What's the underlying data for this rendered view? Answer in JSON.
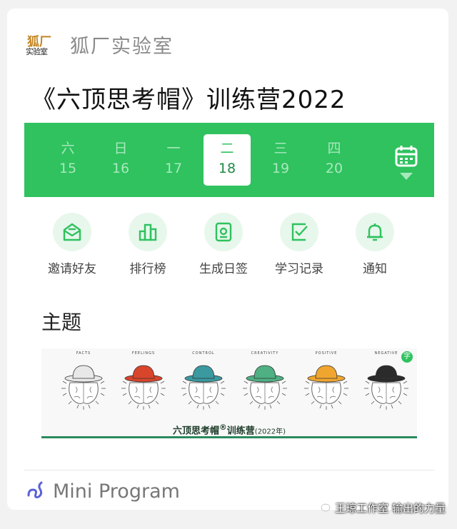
{
  "brand": {
    "logo_line1": "狐厂",
    "logo_line2": "实验室",
    "name": "狐厂实验室"
  },
  "title": "《六顶思考帽》训练营2022",
  "calendar": {
    "days": [
      {
        "weekday": "六",
        "date": "15",
        "selected": false
      },
      {
        "weekday": "日",
        "date": "16",
        "selected": false
      },
      {
        "weekday": "一",
        "date": "17",
        "selected": false
      },
      {
        "weekday": "二",
        "date": "18",
        "selected": true
      },
      {
        "weekday": "三",
        "date": "19",
        "selected": false
      },
      {
        "weekday": "四",
        "date": "20",
        "selected": false
      }
    ],
    "accent": "#2fc25e"
  },
  "actions": [
    {
      "label": "邀请好友",
      "icon": "envelope-icon"
    },
    {
      "label": "排行榜",
      "icon": "leaderboard-icon"
    },
    {
      "label": "生成日签",
      "icon": "daily-card-icon"
    },
    {
      "label": "学习记录",
      "icon": "checklist-icon"
    },
    {
      "label": "通知",
      "icon": "bell-icon"
    }
  ],
  "section_title": "主题",
  "banner": {
    "hats": [
      {
        "label": "FACTS",
        "color": "#e8e8e8"
      },
      {
        "label": "FEELINGS",
        "color": "#d9452b"
      },
      {
        "label": "CONTROL",
        "color": "#3a9aa0"
      },
      {
        "label": "CREATIVITY",
        "color": "#4fb083"
      },
      {
        "label": "POSITIVE",
        "color": "#f0a62e"
      },
      {
        "label": "NEGATIVE",
        "color": "#2b2b2b"
      }
    ],
    "title": "六顶思考帽",
    "title_mark": "®",
    "title_suffix": "训练营",
    "year": "(2022年)"
  },
  "footer": {
    "label": "Mini Program"
  },
  "watermark": "王琼工作室 输出的力量"
}
